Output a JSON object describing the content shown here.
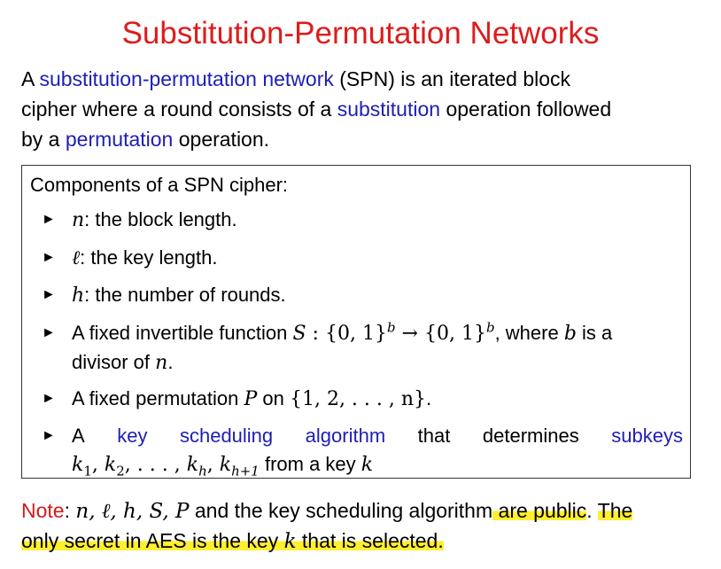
{
  "title": "Substitution-Permutation Networks",
  "intro": {
    "p1": "A ",
    "term_spn": "substitution-permutation network",
    "p2": " (SPN) is an iterated block",
    "p3": "cipher where a round consists of a ",
    "term_sub": "substitution",
    "p4": " operation followed",
    "p5": "by a ",
    "term_perm": "permutation",
    "p6": " operation."
  },
  "box": {
    "heading": "Components of a SPN cipher:",
    "items": [
      {
        "sym": "n",
        "text": ": the block length."
      },
      {
        "sym": "ℓ",
        "text": ": the key length."
      },
      {
        "sym": "h",
        "text": ": the number of rounds."
      },
      {
        "t1": "A fixed invertible function ",
        "m1": "S",
        "m2": " : {0, 1}",
        "sup1": "b",
        "m3": " → {0, 1}",
        "sup2": "b",
        "t2": ", where ",
        "m4": "b",
        "t3": " is a",
        "t4": "divisor of ",
        "m5": "n",
        "t5": "."
      },
      {
        "t1": "A fixed permutation ",
        "m1": "P",
        "t2": " on ",
        "m2": "{1, 2, . . . , n}",
        "t3": "."
      },
      {
        "w1": "A",
        "w2": "key",
        "w3": "scheduling",
        "w4": "algorithm",
        "w5": "that",
        "w6": "determines",
        "w7": "subkeys",
        "k1": "k",
        "s1": "1",
        "c1": ", ",
        "k2": "k",
        "s2": "2",
        "c2": ", . . . , ",
        "kh": "k",
        "sh": "h",
        "c3": ", ",
        "kh1": "k",
        "sh1": "h+1",
        "t1": " from a key ",
        "k": "k"
      }
    ]
  },
  "note": {
    "label": "Note",
    "colon": ": ",
    "symbols": "n, ℓ, h, S, P",
    "t1": " and the key scheduling algorithm",
    "hl1": " are public",
    "t2": ". ",
    "hl2": "The",
    "hl3": "only secret in AES is the key ",
    "k": "k",
    "hl4": " that is selected."
  },
  "bullet_glyph": "►",
  "colors": {
    "title": "#dd1c1c",
    "term": "#1e1eb4",
    "highlight": "#ffef2e"
  }
}
